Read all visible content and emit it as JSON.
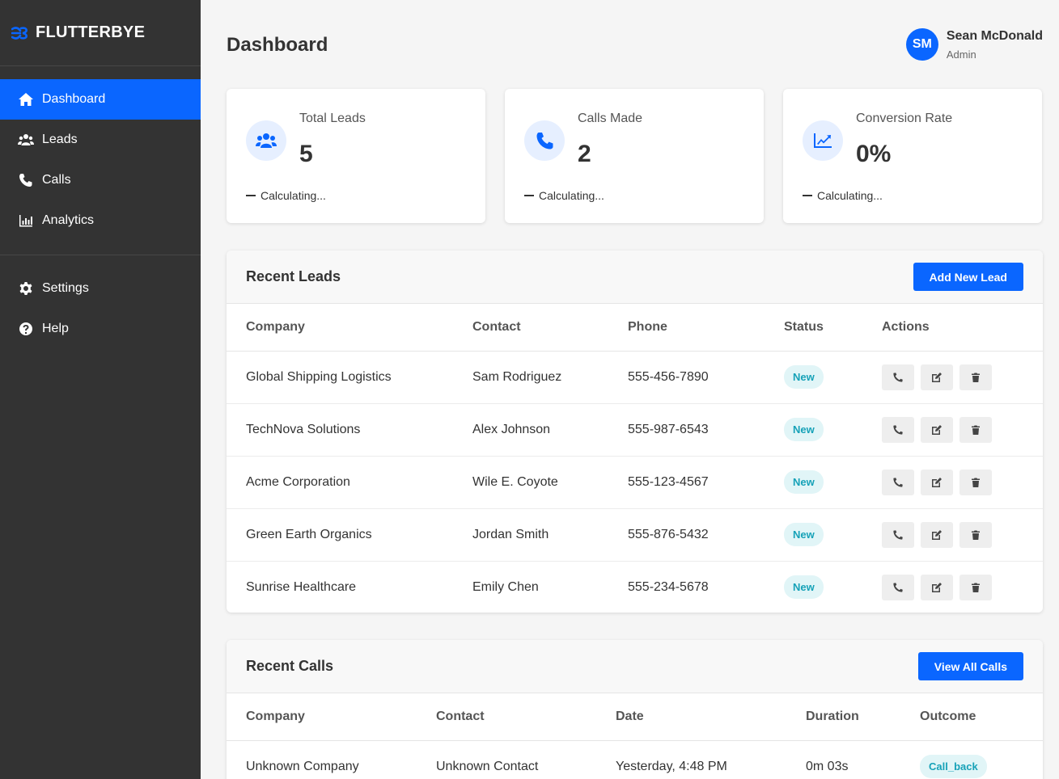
{
  "brand": {
    "name": "FLUTTERBYE",
    "accent": "#0a66ff"
  },
  "sidebar": {
    "primary": [
      {
        "label": "Dashboard",
        "icon": "home-icon"
      },
      {
        "label": "Leads",
        "icon": "users-icon"
      },
      {
        "label": "Calls",
        "icon": "phone-icon"
      },
      {
        "label": "Analytics",
        "icon": "bar-chart-icon"
      }
    ],
    "secondary": [
      {
        "label": "Settings",
        "icon": "gear-icon"
      },
      {
        "label": "Help",
        "icon": "question-circle-icon"
      }
    ]
  },
  "header": {
    "title": "Dashboard",
    "user": {
      "initials": "SM",
      "name": "Sean McDonald",
      "role": "Admin"
    }
  },
  "stats": [
    {
      "label": "Total Leads",
      "value": "5",
      "trend": "Calculating...",
      "icon": "users-icon"
    },
    {
      "label": "Calls Made",
      "value": "2",
      "trend": "Calculating...",
      "icon": "phone-icon"
    },
    {
      "label": "Conversion Rate",
      "value": "0%",
      "trend": "Calculating...",
      "icon": "line-chart-icon"
    }
  ],
  "recent_leads": {
    "title": "Recent Leads",
    "button": "Add New Lead",
    "columns": [
      "Company",
      "Contact",
      "Phone",
      "Status",
      "Actions"
    ],
    "rows": [
      {
        "company": "Global Shipping Logistics",
        "contact": "Sam Rodriguez",
        "phone": "555-456-7890",
        "status": "New"
      },
      {
        "company": "TechNova Solutions",
        "contact": "Alex Johnson",
        "phone": "555-987-6543",
        "status": "New"
      },
      {
        "company": "Acme Corporation",
        "contact": "Wile E. Coyote",
        "phone": "555-123-4567",
        "status": "New"
      },
      {
        "company": "Green Earth Organics",
        "contact": "Jordan Smith",
        "phone": "555-876-5432",
        "status": "New"
      },
      {
        "company": "Sunrise Healthcare",
        "contact": "Emily Chen",
        "phone": "555-234-5678",
        "status": "New"
      }
    ]
  },
  "recent_calls": {
    "title": "Recent Calls",
    "button": "View All Calls",
    "columns": [
      "Company",
      "Contact",
      "Date",
      "Duration",
      "Outcome"
    ],
    "rows": [
      {
        "company": "Unknown Company",
        "contact": "Unknown Contact",
        "date": "Yesterday, 4:48 PM",
        "duration": "0m 03s",
        "outcome": "Call_back"
      }
    ]
  }
}
